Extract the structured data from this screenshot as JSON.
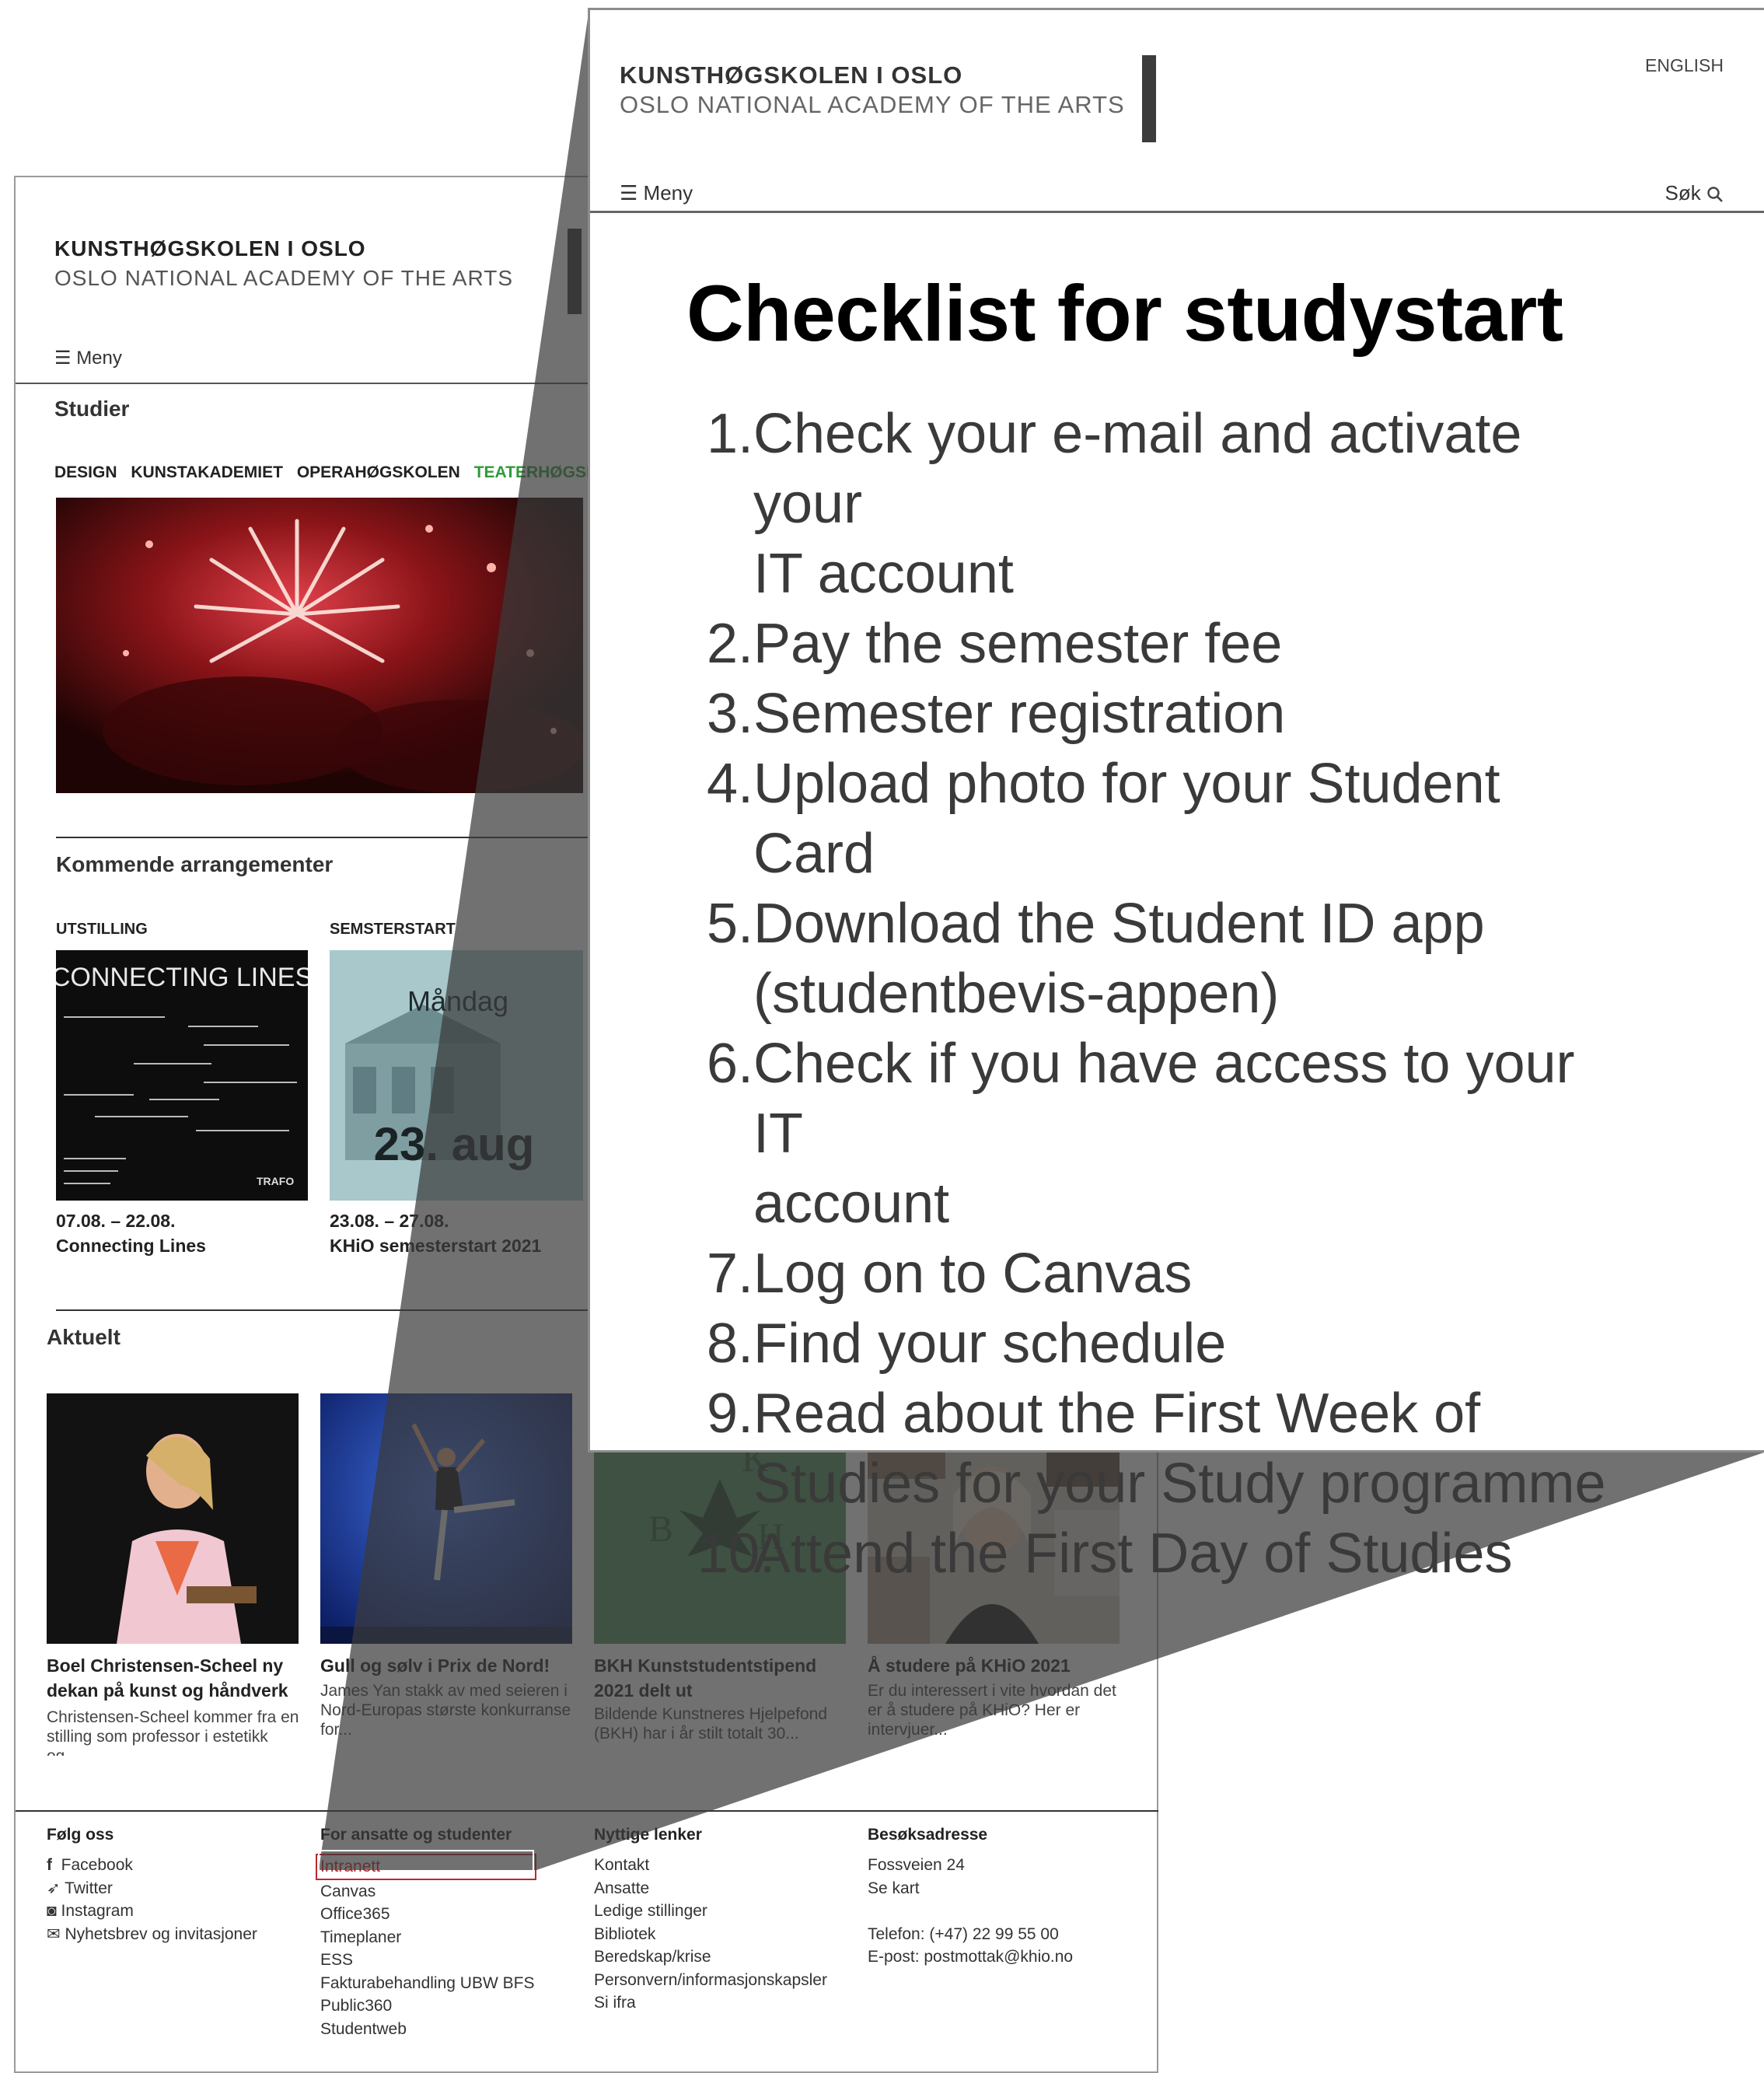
{
  "site": {
    "brand_line1": "KUNSTHØGSKOLEN I OSLO",
    "brand_line2": "OSLO NATIONAL ACADEMY OF THE ARTS",
    "menu_label": "Meny",
    "studier_heading": "Studier",
    "departments": [
      "DESIGN",
      "KUNSTAKADEMIET",
      "OPERAHØGSKOLEN",
      "TEATERHØGSKO"
    ],
    "events_heading": "Kommende arrangementer",
    "events": [
      {
        "category": "UTSTILLING",
        "poster_title": "CONNECTING LINES",
        "dates": "07.08. – 22.08.",
        "title": "Connecting Lines",
        "poster_logo": "TRAFO"
      },
      {
        "category": "SEMSTERSTART",
        "poster_day": "Måndag",
        "poster_date": "23. aug",
        "dates": "23.08. – 27.08.",
        "title": "KHiO semesterstart 2021"
      }
    ],
    "news_heading": "Aktuelt",
    "news": [
      {
        "title": "Boel Christensen-Scheel ny dekan på kunst og håndverk",
        "excerpt": "Christensen-Scheel kommer fra en stilling som professor i estetikk og..."
      },
      {
        "title": "Gull og sølv i Prix de Nord!",
        "excerpt": "James Yan stakk av med seieren i Nord-Europas største konkurranse for..."
      },
      {
        "title": "BKH Kunststudentstipend 2021 delt ut",
        "excerpt": "Bildende Kunstneres Hjelpefond (BKH) har i år stilt totalt 30..."
      },
      {
        "title": "Å studere på KHiO 2021",
        "excerpt": "Er du interessert i vite hvordan det er å studere på KHiO? Her er intervjuer..."
      }
    ],
    "footer": {
      "follow_heading": "Følg oss",
      "follow": [
        "Facebook",
        "Twitter",
        "Instagram",
        "Nyhetsbrev og invitasjoner"
      ],
      "staff_heading": "For ansatte og studenter",
      "staff_links": [
        "Intranett",
        "Canvas",
        "Office365",
        "Timeplaner",
        "ESS",
        "Fakturabehandling UBW BFS",
        "Public360",
        "Studentweb"
      ],
      "useful_heading": "Nyttige lenker",
      "useful_links": [
        "Kontakt",
        "Ansatte",
        "Ledige stillinger",
        "Bibliotek",
        "Beredskap/krise",
        "Personvern/informasjonskapsler",
        "Si ifra"
      ],
      "visit_heading": "Besøksadresse",
      "visit_lines": [
        "Fossveien 24",
        "Se kart"
      ],
      "contact_lines": [
        "Telefon: (+47) 22 99 55 00",
        "E-post: postmottak@khio.no"
      ]
    }
  },
  "panel": {
    "brand_line1": "KUNSTHØGSKOLEN I OSLO",
    "brand_line2": "OSLO NATIONAL ACADEMY OF THE ARTS",
    "language_link": "ENGLISH",
    "menu_label": "Meny",
    "search_label": "Søk",
    "title": "Checklist for studystart",
    "items": [
      {
        "num": "1.",
        "line1": "Check your e-mail and activate your",
        "line2": "IT account"
      },
      {
        "num": "2.",
        "line1": "Pay the semester fee",
        "line2": ""
      },
      {
        "num": "3.",
        "line1": "Semester registration",
        "line2": ""
      },
      {
        "num": "4.",
        "line1": "Upload photo for your Student Card",
        "line2": ""
      },
      {
        "num": "5.",
        "line1": "Download the Student ID app",
        "line2": "(studentbevis-appen)"
      },
      {
        "num": "6.",
        "line1": "Check if you have access to your IT",
        "line2": "account"
      },
      {
        "num": "7.",
        "line1": "Log on to Canvas",
        "line2": ""
      },
      {
        "num": "8.",
        "line1": "Find your schedule",
        "line2": ""
      },
      {
        "num": "9.",
        "line1": "Read about the First Week of",
        "line2": "Studies for your Study programme"
      },
      {
        "num": "10.",
        "line1": "Attend the First Day of Studies",
        "line2": ""
      }
    ]
  },
  "colors": {
    "highlight": "#2e9b3a",
    "intranet": "#c0272d",
    "wedge": "#3a3a3a"
  },
  "icons": [
    "menu-icon",
    "search-icon",
    "facebook-icon",
    "twitter-icon",
    "instagram-icon",
    "mail-icon"
  ]
}
